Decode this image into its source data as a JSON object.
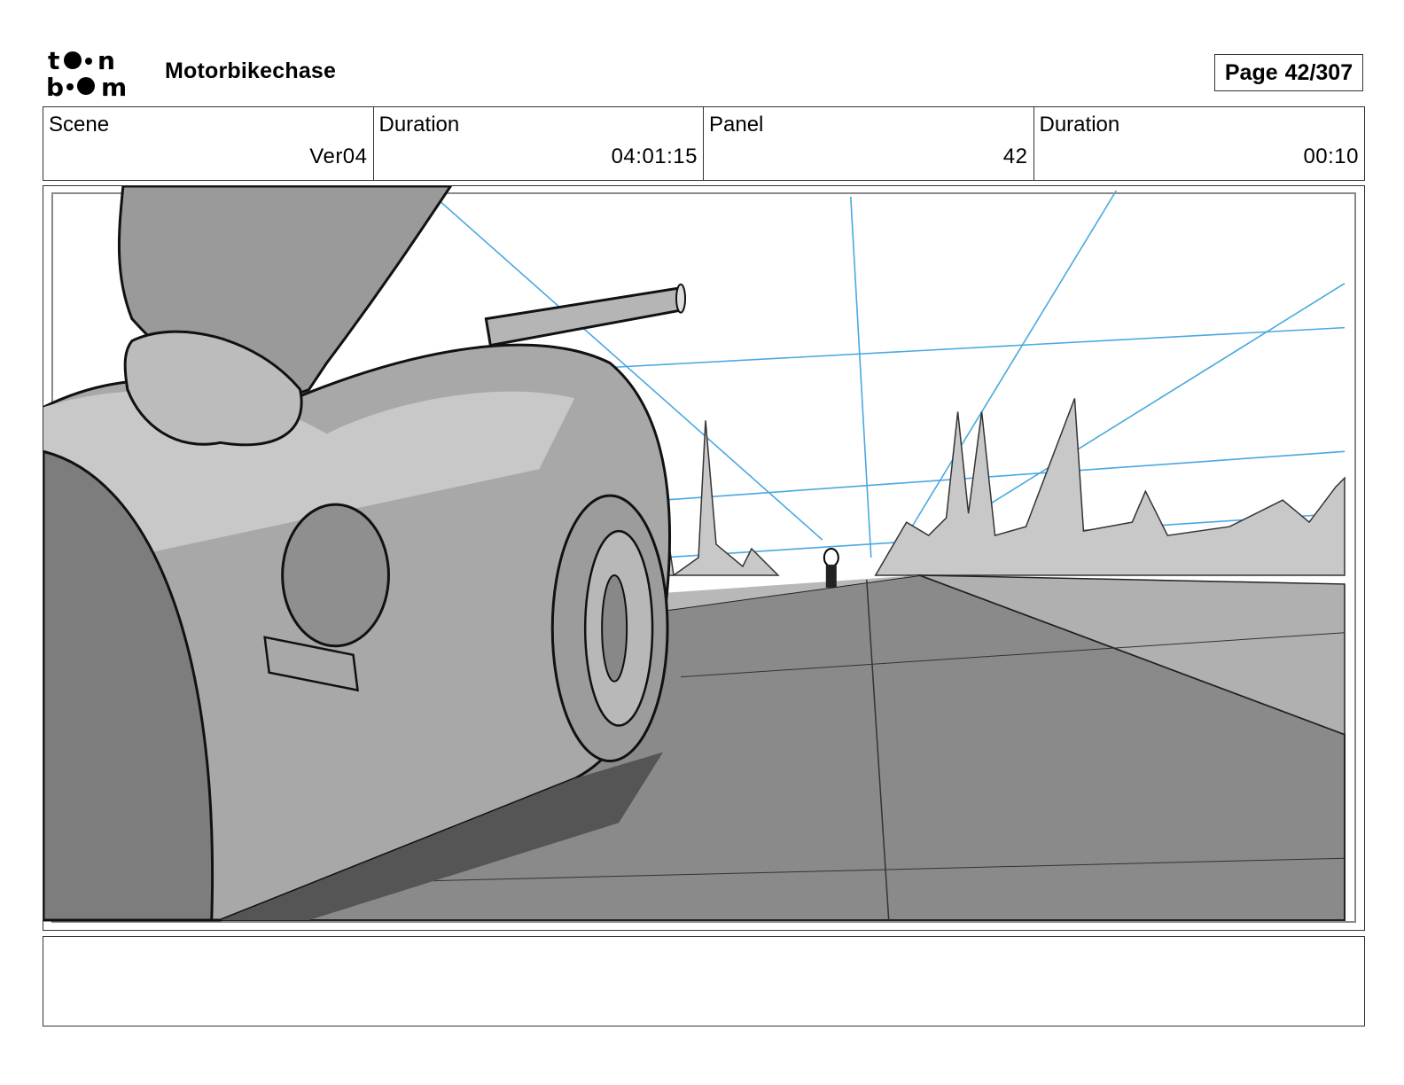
{
  "header": {
    "logo_text": "toon boom",
    "project_title": "Motorbikechase",
    "page": {
      "label": "Page",
      "value": "42/307"
    }
  },
  "info": [
    {
      "label": "Scene",
      "value": "Ver04"
    },
    {
      "label": "Duration",
      "value": "04:01:15"
    },
    {
      "label": "Panel",
      "value": "42"
    },
    {
      "label": "Duration",
      "value": "00:10"
    }
  ],
  "panel": {
    "icon": "storyboard-sketch",
    "colors": {
      "guide_lines": "#4aa8e0",
      "road": "#8a8a8a",
      "bike": "#a8a8a8",
      "shadow": "#555555"
    }
  },
  "notes": {
    "text": ""
  }
}
